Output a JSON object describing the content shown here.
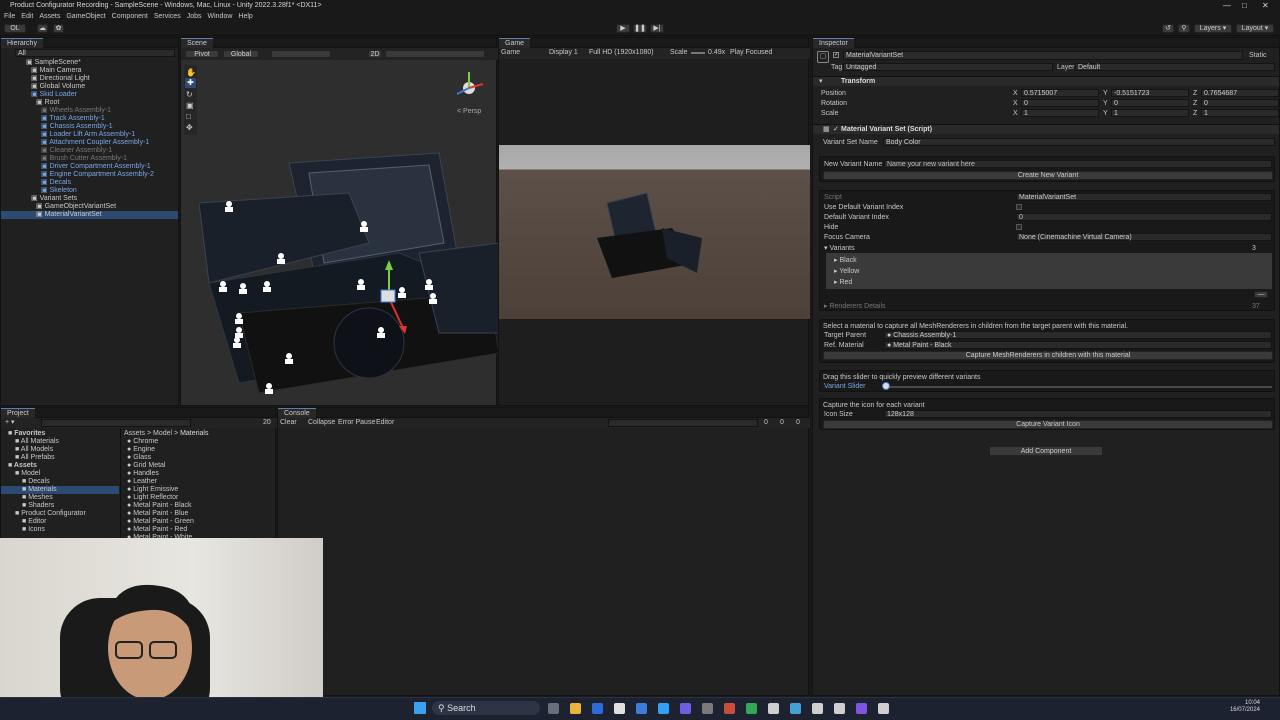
{
  "window": {
    "title": "Product Configurator Recording - SampleScene - Windows, Mac, Linux - Unity 2022.3.28f1* <DX11>"
  },
  "menu": [
    "File",
    "Edit",
    "Assets",
    "GameObject",
    "Component",
    "Services",
    "Jobs",
    "Window",
    "Help"
  ],
  "toolbar": {
    "account": "OL",
    "layers": "Layers",
    "layout": "Layout"
  },
  "hierarchy": {
    "title": "Hierarchy",
    "search": "All",
    "items": [
      {
        "label": "SampleScene*",
        "cls": ""
      },
      {
        "label": "Main Camera",
        "cls": ""
      },
      {
        "label": "Directional Light",
        "cls": ""
      },
      {
        "label": "Global Volume",
        "cls": ""
      },
      {
        "label": "Skid Loader",
        "cls": "blue"
      },
      {
        "label": "Root",
        "cls": ""
      },
      {
        "label": "Wheels Assembly-1",
        "cls": "dim"
      },
      {
        "label": "Track Assembly-1",
        "cls": "blue"
      },
      {
        "label": "Chassis Assembly-1",
        "cls": "blue"
      },
      {
        "label": "Loader Lift Arm Assembly-1",
        "cls": "blue"
      },
      {
        "label": "Attachment Coupler Assembly-1",
        "cls": "blue"
      },
      {
        "label": "Cleaner Assembly-1",
        "cls": "dim"
      },
      {
        "label": "Brush Cutter Assembly-1",
        "cls": "dim"
      },
      {
        "label": "Driver Compartment Assembly-1",
        "cls": "blue"
      },
      {
        "label": "Engine Compartment Assembly-2",
        "cls": "blue"
      },
      {
        "label": "Decals",
        "cls": "blue"
      },
      {
        "label": "Skeleton",
        "cls": "blue"
      },
      {
        "label": "Variant Sets",
        "cls": ""
      },
      {
        "label": "GameObjectVariantSet",
        "cls": ""
      },
      {
        "label": "MaterialVariantSet",
        "cls": "sel"
      }
    ]
  },
  "scene": {
    "tab": "Scene",
    "pivot": "Pivot",
    "global": "Global",
    "mode": "2D",
    "persp": "< Persp"
  },
  "game": {
    "tab": "Game",
    "mode": "Game",
    "display": "Display 1",
    "resolution": "Full HD (1920x1080)",
    "scale_label": "Scale",
    "scale_value": "0.49x",
    "play_focused": "Play Focused"
  },
  "project": {
    "tab": "Project",
    "breadcrumb": [
      "Assets",
      "Model",
      "Materials"
    ],
    "tree": [
      {
        "label": "Favorites",
        "bold": true
      },
      {
        "label": "All Materials"
      },
      {
        "label": "All Models"
      },
      {
        "label": "All Prefabs"
      },
      {
        "label": "Assets",
        "bold": true
      },
      {
        "label": "Model"
      },
      {
        "label": "Decals"
      },
      {
        "label": "Materials",
        "sel": true
      },
      {
        "label": "Meshes"
      },
      {
        "label": "Shaders"
      },
      {
        "label": "Product Configurator"
      },
      {
        "label": "Editor"
      },
      {
        "label": "Icons"
      }
    ],
    "files": [
      "Chrome",
      "Engine",
      "Glass",
      "Grid Metal",
      "Handles",
      "Leather",
      "Light Emissive",
      "Light Reflector",
      "Metal Paint - Black",
      "Metal Paint - Blue",
      "Metal Paint - Green",
      "Metal Paint - Red",
      "Metal Paint - White"
    ],
    "count": "20"
  },
  "console": {
    "tab": "Console",
    "clear": "Clear",
    "collapse": "Collapse",
    "error_pause": "Error Pause",
    "editor": "Editor",
    "c1": "0",
    "c2": "0",
    "c3": "0"
  },
  "inspector": {
    "tab": "Inspector",
    "object_name": "MaterialVariantSet",
    "static": "Static",
    "tag_label": "Tag",
    "tag": "Untagged",
    "layer_label": "Layer",
    "layer": "Default",
    "transform": {
      "title": "Transform",
      "position_label": "Position",
      "px": "0.5715007",
      "py": "-0.5151723",
      "pz": "0.7654687",
      "rotation_label": "Rotation",
      "rx": "0",
      "ry": "0",
      "rz": "0",
      "scale_label": "Scale",
      "sx": "1",
      "sy": "1",
      "sz": "1"
    },
    "script": {
      "title": "Material Variant Set (Script)",
      "variant_set_name_label": "Variant Set Name",
      "variant_set_name": "Body Color",
      "new_variant_label": "New Variant Name",
      "new_variant_placeholder": "Name your new variant here",
      "create_button": "Create New Variant",
      "script_label": "Script",
      "script_value": "MaterialVariantSet",
      "use_default_label": "Use Default Variant Index",
      "default_index_label": "Default Variant Index",
      "default_index": "0",
      "hide_label": "Hide",
      "focus_camera_label": "Focus Camera",
      "focus_camera": "None (Cinemachine Virtual Camera)",
      "variants_label": "Variants",
      "variants_count": "3",
      "variants": [
        "Black",
        "Yellow",
        "Red"
      ],
      "renderers_label": "Renderers Details",
      "renderers_count": "37",
      "capture_help": "Select a material to capture all MeshRenderers in children from the target parent with this material.",
      "target_parent_label": "Target Parent",
      "target_parent": "Chassis Assembly-1",
      "ref_material_label": "Ref. Material",
      "ref_material": "Metal Paint - Black",
      "capture_button": "Capture MeshRenderers in children with this material",
      "slider_help": "Drag this slider to quickly preview different variants",
      "slider_label": "Variant Slider",
      "slider_value": 0,
      "icon_help": "Capture the icon for each variant",
      "icon_size_label": "Icon Size",
      "icon_size": "128x128",
      "capture_icon_button": "Capture Variant Icon"
    },
    "add_component": "Add Component"
  },
  "taskbar": {
    "search": "Search",
    "time": "10:04",
    "date": "16/07/2024"
  }
}
